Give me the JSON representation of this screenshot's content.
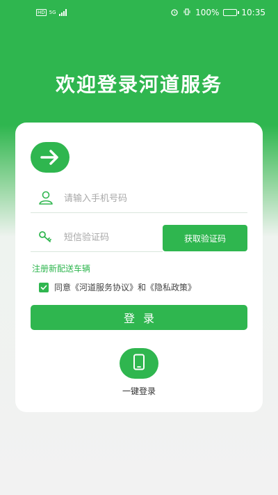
{
  "status_bar": {
    "network": "5G",
    "hd": "HD",
    "battery_percent": "100%",
    "time": "10:35"
  },
  "welcome_title": "欢迎登录河道服务",
  "form": {
    "phone_placeholder": "请输入手机号码",
    "sms_placeholder": "短信验证码",
    "get_code_label": "获取验证码",
    "register_link": "注册新配送车辆",
    "agreement_text": "同意《河道服务协议》和《隐私政策》",
    "agreement_checked": true,
    "login_label": "登录"
  },
  "one_key_login_label": "一键登录",
  "colors": {
    "brand_green": "#2fb64f",
    "placeholder": "#a8a8a8"
  }
}
